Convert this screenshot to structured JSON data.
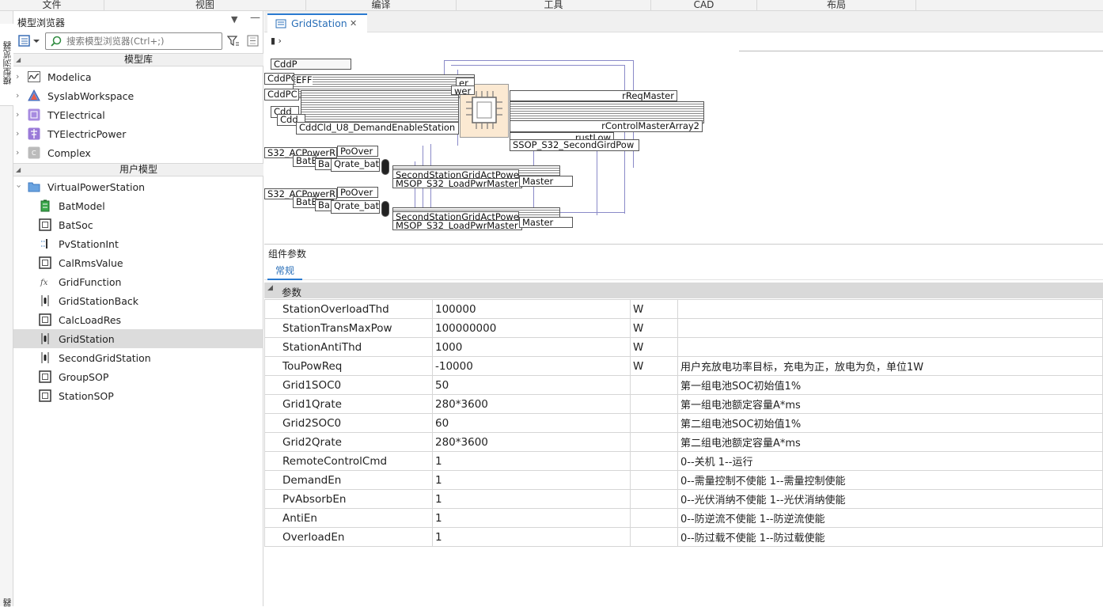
{
  "menubar": [
    "文件",
    "视图",
    "编译",
    "工具",
    "CAD",
    "布局"
  ],
  "side_strip": {
    "label": "模型浏览器",
    "bottom_label": "器"
  },
  "browser": {
    "title": "模型浏览器",
    "search_placeholder": "搜索模型浏览器(Ctrl+;)",
    "library_section": "模型库",
    "libraries": [
      {
        "name": "Modelica",
        "icon": "modelica-icon"
      },
      {
        "name": "SyslabWorkspace",
        "icon": "syslab-icon"
      },
      {
        "name": "TYElectrical",
        "icon": "tyelectrical-icon"
      },
      {
        "name": "TYElectricPower",
        "icon": "tyelectricpower-icon"
      },
      {
        "name": "Complex",
        "icon": "complex-icon"
      }
    ],
    "user_section": "用户模型",
    "root": {
      "name": "VirtualPowerStation",
      "icon": "folder-icon"
    },
    "models": [
      {
        "name": "BatModel",
        "icon": "battery-icon"
      },
      {
        "name": "BatSoc",
        "icon": "block-icon"
      },
      {
        "name": "PvStationInt",
        "icon": "connector-icon"
      },
      {
        "name": "CalRmsValue",
        "icon": "block-icon"
      },
      {
        "name": "GridFunction",
        "icon": "function-icon"
      },
      {
        "name": "GridStationBack",
        "icon": "station-icon"
      },
      {
        "name": "CalcLoadRes",
        "icon": "block-icon"
      },
      {
        "name": "GridStation",
        "icon": "station-icon"
      },
      {
        "name": "SecondGridStation",
        "icon": "station-icon"
      },
      {
        "name": "GroupSOP",
        "icon": "block-icon"
      },
      {
        "name": "StationSOP",
        "icon": "block-icon"
      }
    ],
    "selected": "GridStation"
  },
  "editor": {
    "tab_label": "GridStation",
    "breadcrumb": "▮ ›"
  },
  "diagram": {
    "blocks": [
      "CddP",
      "EFF",
      "CddPC",
      "Cdd",
      "Cdd",
      "CddCld_U8_DemandEnableStation",
      "er",
      "wer",
      "rReqMaster",
      "rControlMasterArray2",
      "SSOP_S32_SecondGirdPow",
      "rustLow",
      "S32_ACPowerR",
      "PoOver",
      "BatE",
      "Ba",
      "Qrate_bat",
      "SecondStationGridActPower",
      "MSOP_S32_LoadPwrMaster",
      "er",
      "Master",
      "S32_ACPowerR",
      "PoOver",
      "BatE",
      "Ba",
      "Qrate_bat",
      "SecondStationGridActPower",
      "MSOP_S32_LoadPwrMaster",
      "er",
      "Master"
    ]
  },
  "params": {
    "title": "组件参数",
    "tab": "常规",
    "group": "参数",
    "rows": [
      {
        "name": "StationOverloadThd",
        "value": "100000",
        "unit": "W",
        "desc": ""
      },
      {
        "name": "StationTransMaxPow",
        "value": "100000000",
        "unit": "W",
        "desc": ""
      },
      {
        "name": "StationAntiThd",
        "value": "1000",
        "unit": "W",
        "desc": ""
      },
      {
        "name": "TouPowReq",
        "value": "-10000",
        "unit": "W",
        "desc": "用户充放电功率目标，充电为正，放电为负，单位1W"
      },
      {
        "name": "Grid1SOC0",
        "value": "50",
        "unit": "",
        "desc": "第一组电池SOC初始值1%"
      },
      {
        "name": "Grid1Qrate",
        "value": "280*3600",
        "unit": "",
        "desc": "第一组电池额定容量A*ms"
      },
      {
        "name": "Grid2SOC0",
        "value": "60",
        "unit": "",
        "desc": "第二组电池SOC初始值1%"
      },
      {
        "name": "Grid2Qrate",
        "value": "280*3600",
        "unit": "",
        "desc": "第二组电池额定容量A*ms"
      },
      {
        "name": "RemoteControlCmd",
        "value": "1",
        "unit": "",
        "desc": "0--关机 1--运行"
      },
      {
        "name": "DemandEn",
        "value": "1",
        "unit": "",
        "desc": "0--需量控制不使能 1--需量控制使能"
      },
      {
        "name": "PvAbsorbEn",
        "value": "1",
        "unit": "",
        "desc": "0--光伏消纳不使能 1--光伏消纳使能"
      },
      {
        "name": "AntiEn",
        "value": "1",
        "unit": "",
        "desc": "0--防逆流不使能 1--防逆流使能"
      },
      {
        "name": "OverloadEn",
        "value": "1",
        "unit": "",
        "desc": "0--防过载不使能 1--防过载使能"
      }
    ]
  }
}
